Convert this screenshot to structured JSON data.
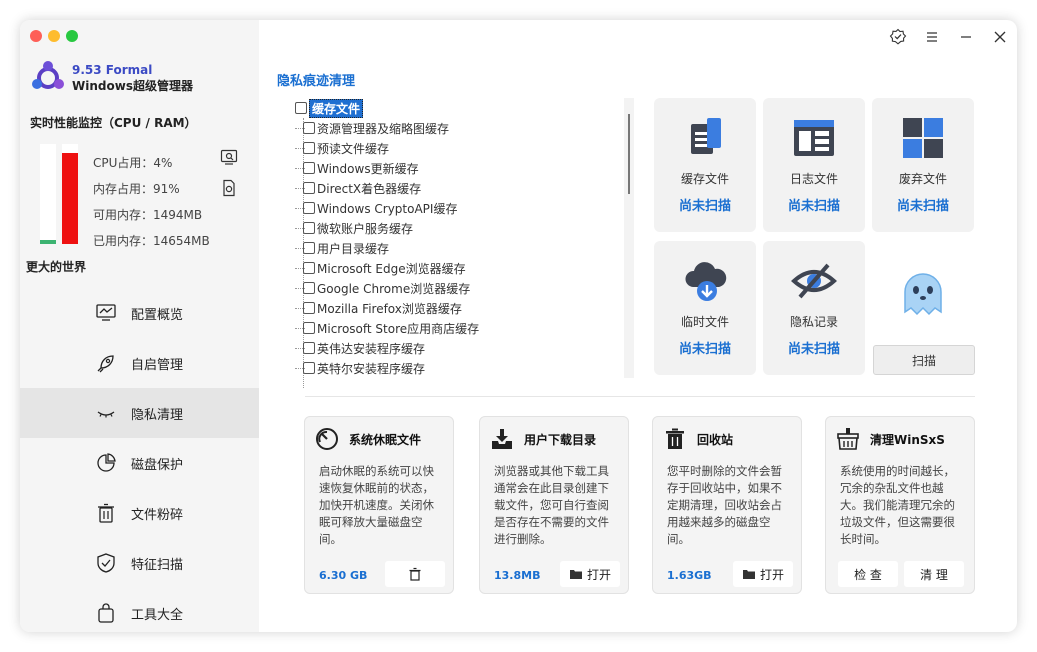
{
  "app": {
    "version": "9.53 Formal",
    "name": "Windows超级管理器"
  },
  "performance": {
    "title": "实时性能监控（CPU / RAM）",
    "cpu_percent": 4,
    "mem_percent": 91,
    "cpu_label": "CPU占用：4%",
    "mem_label": "内存占用：91%",
    "avail_label": "可用内存：1494MB",
    "used_label": "已用内存：14654MB",
    "colors": {
      "cpu": "#3cb371",
      "mem": "#ee1111"
    }
  },
  "slogan": "更大的世界",
  "nav": [
    {
      "label": "配置概览",
      "icon": "monitor-chart-icon"
    },
    {
      "label": "自启管理",
      "icon": "rocket-icon"
    },
    {
      "label": "隐私清理",
      "icon": "closed-eye-icon",
      "active": true
    },
    {
      "label": "磁盘保护",
      "icon": "pie-chart-icon"
    },
    {
      "label": "文件粉碎",
      "icon": "trash-icon"
    },
    {
      "label": "特征扫描",
      "icon": "shield-check-icon"
    },
    {
      "label": "工具大全",
      "icon": "bag-icon"
    }
  ],
  "main": {
    "title": "隐私痕迹清理",
    "tree": {
      "root": "缓存文件",
      "items": [
        "资源管理器及缩略图缓存",
        "预读文件缓存",
        "Windows更新缓存",
        "DirectX着色器缓存",
        "Windows CryptoAPI缓存",
        "微软账户服务缓存",
        "用户目录缓存",
        "Microsoft Edge浏览器缓存",
        "Google Chrome浏览器缓存",
        "Mozilla Firefox浏览器缓存",
        "Microsoft Store应用商店缓存",
        "英伟达安装程序缓存",
        "英特尔安装程序缓存"
      ]
    },
    "tiles": [
      {
        "label": "缓存文件",
        "status": "尚未扫描",
        "icon": "cache-files-icon"
      },
      {
        "label": "日志文件",
        "status": "尚未扫描",
        "icon": "log-files-icon"
      },
      {
        "label": "废弃文件",
        "status": "尚未扫描",
        "icon": "obsolete-files-icon"
      },
      {
        "label": "临时文件",
        "status": "尚未扫描",
        "icon": "temp-cloud-icon"
      },
      {
        "label": "隐私记录",
        "status": "尚未扫描",
        "icon": "privacy-eye-icon"
      }
    ],
    "scan_label": "扫描"
  },
  "cards": [
    {
      "title": "系统休眠文件",
      "desc": "启动休眠的系统可以快速恢复休眠前的状态，加快开机速度。关闭休眠可释放大量磁盘空间。",
      "size": "6.30 GB",
      "button": ""
    },
    {
      "title": "用户下载目录",
      "desc": "浏览器或其他下载工具通常会在此目录创建下载文件，您可自行查阅是否存在不需要的文件进行删除。",
      "size": "13.8MB",
      "button": "打开"
    },
    {
      "title": "回收站",
      "desc": "您平时删除的文件会暂存于回收站中，如果不定期清理，回收站会占用越来越多的磁盘空间。",
      "size": "1.63GB",
      "button": "打开"
    },
    {
      "title": "清理WinSxS",
      "desc": "系统使用的时间越长，冗余的杂乱文件也越大。我们能清理冗余的垃圾文件，但这需要很长时间。",
      "check": "检 查",
      "clean": "清 理"
    }
  ]
}
